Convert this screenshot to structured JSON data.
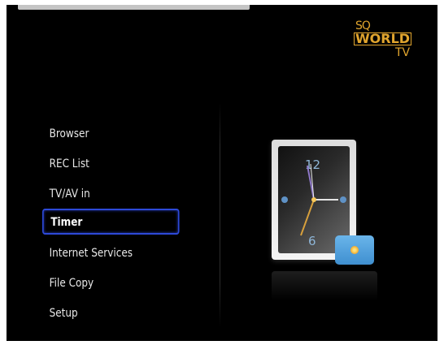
{
  "logo": {
    "line1": "SQ",
    "line2": "WORLD",
    "line3": "TV"
  },
  "menu": {
    "items": [
      {
        "label": "Browser"
      },
      {
        "label": "REC List"
      },
      {
        "label": "TV/AV in"
      },
      {
        "label": "Timer",
        "selected": true
      },
      {
        "label": "Internet Services"
      },
      {
        "label": "File Copy"
      },
      {
        "label": "Setup"
      }
    ]
  },
  "clock": {
    "top_number": "12",
    "bottom_number": "6"
  },
  "colors": {
    "accent": "#2d49d8",
    "logo": "#e1a52e",
    "background": "#000000"
  },
  "icons": {
    "illustration": "clock-icon",
    "camera": "camera-icon"
  }
}
